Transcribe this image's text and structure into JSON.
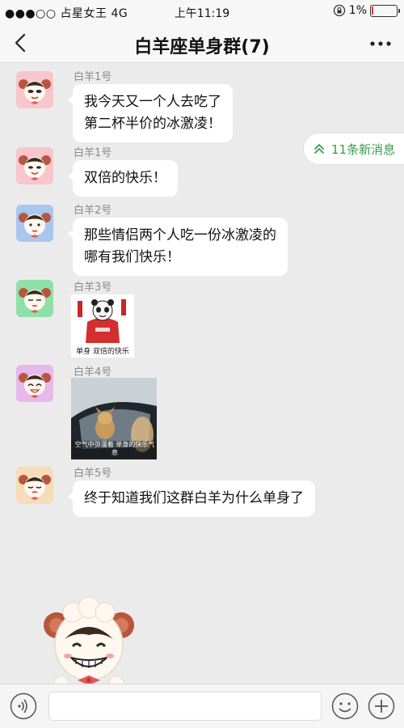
{
  "status_bar": {
    "carrier": "●●●○○ 占星女王 4G",
    "time": "上午11:19",
    "battery": "1%",
    "battery_level": 0.01
  },
  "header": {
    "title": "白羊座单身群(7)",
    "back_icon": "chevron-left-icon",
    "more_icon": "more-dots-icon"
  },
  "new_messages": {
    "label": "11条新消息",
    "icon": "double-chevron-up-icon",
    "color": "#3a9a4a"
  },
  "messages": [
    {
      "sender": "白羊1号",
      "lines": [
        "我今天又一个人去吃了",
        "第二杯半价的冰激凌！"
      ],
      "avatar_bg": "#f7c6cc"
    },
    {
      "sender": "白羊1号",
      "lines": [
        "双倍的快乐！"
      ],
      "avatar_bg": "#f7c6cc"
    },
    {
      "sender": "白羊2号",
      "lines": [
        "那些情侣两个人吃一份冰激凌的",
        "哪有我们快乐！"
      ],
      "avatar_bg": "#a9c6ef"
    },
    {
      "sender": "白羊3号",
      "sticker_caption": "单身 双倍的快乐",
      "avatar_bg": "#8fe0a8"
    },
    {
      "sender": "白羊4号",
      "sticker_caption": "空气中弥漫着 单身的快乐气息",
      "avatar_bg": "#e7b8ea"
    },
    {
      "sender": "白羊5号",
      "lines": [
        "终于知道我们这群白羊为什么单身了"
      ],
      "avatar_bg": "#f6dcb8"
    }
  ],
  "input_bar": {
    "voice_icon": "voice-icon",
    "emoji_icon": "emoji-icon",
    "plus_icon": "plus-icon"
  }
}
